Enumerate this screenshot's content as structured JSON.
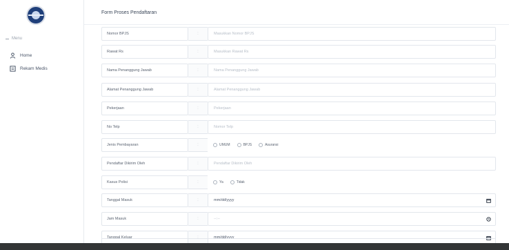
{
  "sidebar": {
    "menu_header": "Menu",
    "items": [
      {
        "label": "Home",
        "icon": "person-icon"
      },
      {
        "label": "Rekam Medis",
        "icon": "document-icon"
      }
    ]
  },
  "header": {
    "title": "Form Proses Pendaftaran"
  },
  "form": {
    "colon": ":",
    "fields": [
      {
        "label": "Nomor BPJS",
        "placeholder": "Masukkan Nomor BPJS"
      },
      {
        "label": "Rawat Rs",
        "placeholder": "Masukkan Rawat Rs"
      },
      {
        "label": "Nama Penanggung Jawab",
        "placeholder": "Nama Penanggung Jawab"
      },
      {
        "label": "Alamat Penanggung Jawab",
        "placeholder": "Alamat Penanggung Jawab"
      },
      {
        "label": "Pekerjaan",
        "placeholder": "Pekerjaan"
      },
      {
        "label": "No Telp",
        "placeholder": "Nomor Telp"
      },
      {
        "label": "Jenis Pembayaran",
        "options": [
          "UMUM",
          "BPJS",
          "Asuransi"
        ]
      },
      {
        "label": "Pendaftar Dikirim Oleh",
        "placeholder": "Pendaftar Dikirim Oleh"
      },
      {
        "label": "Kasus Polisi",
        "options": [
          "Ya",
          "Tidak"
        ]
      },
      {
        "label": "Tanggal Masuk",
        "value": "mm/dd/yyyy",
        "icon": "calendar-icon"
      },
      {
        "label": "Jam Masuk",
        "value": "--:--",
        "icon": "clock-icon"
      },
      {
        "label": "Tanggal Keluar",
        "value": "mm/dd/yyyy",
        "icon": "calendar-icon"
      }
    ]
  }
}
